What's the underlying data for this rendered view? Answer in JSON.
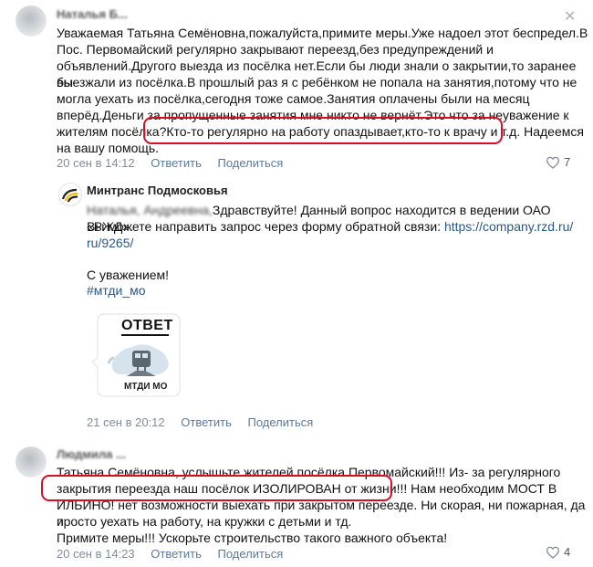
{
  "comment1": {
    "author": "Наталья Б...",
    "text": "Уважаемая Татьяна Семёновна,пожалуйста,примите меры.Уже надоел этот беспредел.В Пос. Первомайский регулярно закрывают переезд,без предупреждений и объявлений.Другого выезда из посёлка нет.Если бы люди знали о закрытии,то заранее бы выезжали из посёлка.В прошлый раз я с ребёнком не попала на занятия,потому что не могла уехать из посёлка,сегодня тоже самое.Занятия оплачены были на месяц вперёд.Деньги за пропущенные занятия мне никто не вернёт.Это что за неуважение к жителям посёлка?Кто-то регулярно на работу опаздывает,кто-то к врачу и т.д. Надеемся на вашу помощь.",
    "lines": [
      "Уважаемая Татьяна Семёновна,пожалуйста,примите меры.Уже надоел этот беспредел.В",
      "Пос. Первомайский регулярно закрывают переезд,без предупреждений и",
      "объявлений.Другого выезда из посёлка нет.Если бы люди знали о закрытии,то заранее бы",
      "выезжали из посёлка.В прошлый раз я с ребёнком не попала на занятия,потому что не",
      "могла уехать из посёлка,сегодня тоже самое.Занятия оплачены были на месяц",
      "вперёд.Деньги за пропущенные занятия мне никто не вернёт.Это что за неуважение к",
      "жителям посёлка?Кто-то регулярно на работу опаздывает,кто-то к врачу и т.д. Надеемся",
      "на вашу помощь."
    ],
    "date": "20 сен в 14:12",
    "reply": "Ответить",
    "share": "Поделиться",
    "likes": "7"
  },
  "reply1": {
    "author": "Минтранс Подмосковья",
    "greeting_name": "Наталья, Андреевна,",
    "greeting": "Здравствуйте! Данный вопрос находится в ведении ОАО «РЖД».",
    "line2": "Вы можете направить запрос через форму обратной связи:",
    "link1": "https://company.rzd.ru/",
    "link2": "ru/9265/",
    "sign": "С уважением!",
    "hashtag": "#мтди_мо",
    "sticker_title": "ОТВЕТ",
    "sticker_caption": "МТДИ МО",
    "date": "21 сен в 20:12",
    "reply": "Ответить",
    "share": "Поделиться"
  },
  "comment2": {
    "author": "Людмила ...",
    "lines": [
      "Татьяна Семёновна, услышьте жителей посёлка Первомайский!!! Из- за регулярного",
      "закрытия переезда наш посёлок ИЗОЛИРОВАН от жизни!!! Нам необходим МОСТ В",
      "ИЛЬИНО! нет возможности выехать при закрытом переезде. Ни скорая, ни пожарная, да и",
      "просто уехать на работу, на кружки с детьми и тд.",
      "Примите меры!!! Ускорьте строительство такого важного объекта!"
    ],
    "date": "20 сен в 14:23",
    "reply": "Ответить",
    "share": "Поделиться",
    "likes": "4"
  },
  "colors": {
    "accent": "#2a5885",
    "annotation": "#d1102a",
    "meta": "#818c99"
  }
}
